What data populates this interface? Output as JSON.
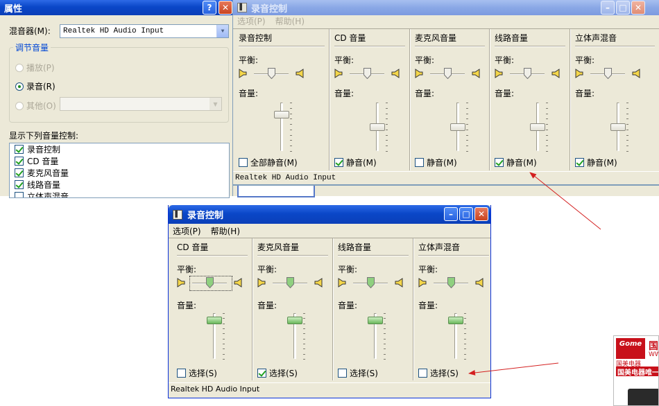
{
  "props": {
    "title": "属性",
    "help_btn": "?",
    "mixer_label": "混音器(M):",
    "mixer_value": "Realtek HD Audio Input",
    "adjust_group": "调节音量",
    "radio_playback": "播放(P)",
    "radio_record": "录音(R)",
    "radio_other": "其他(O)",
    "show_label": "显示下列音量控制:",
    "list": [
      {
        "label": "录音控制",
        "checked": true
      },
      {
        "label": "CD 音量",
        "checked": true
      },
      {
        "label": "麦克风音量",
        "checked": true
      },
      {
        "label": "线路音量",
        "checked": true
      },
      {
        "label": "立体声混音",
        "checked": false
      }
    ]
  },
  "rec1": {
    "title": "录音控制",
    "menu": [
      "选项(P)",
      "帮助(H)"
    ],
    "balance": "平衡:",
    "volume": "音量:",
    "cols": [
      {
        "title": "录音控制",
        "check_label": "全部静音(M)",
        "checked": false,
        "volume": 0.8
      },
      {
        "title": "CD 音量",
        "check_label": "静音(M)",
        "checked": true,
        "volume": 0.5
      },
      {
        "title": "麦克风音量",
        "check_label": "静音(M)",
        "checked": false,
        "volume": 0.5
      },
      {
        "title": "线路音量",
        "check_label": "静音(M)",
        "checked": true,
        "volume": 0.5
      },
      {
        "title": "立体声混音",
        "check_label": "静音(M)",
        "checked": true,
        "volume": 0.5
      }
    ],
    "status": "Realtek HD Audio Input"
  },
  "rec2": {
    "title": "录音控制",
    "menu": [
      "选项(P)",
      "帮助(H)"
    ],
    "balance": "平衡:",
    "volume": "音量:",
    "cols": [
      {
        "title": "CD 音量",
        "check_label": "选择(S)",
        "checked": false,
        "volume": 0.9
      },
      {
        "title": "麦克风音量",
        "check_label": "选择(S)",
        "checked": true,
        "volume": 0.9
      },
      {
        "title": "线路音量",
        "check_label": "选择(S)",
        "checked": false,
        "volume": 0.9
      },
      {
        "title": "立体声混音",
        "check_label": "选择(S)",
        "checked": false,
        "volume": 0.9
      }
    ],
    "status": "Realtek HD Audio Input"
  },
  "ad": {
    "logo": "Gome",
    "brand": "国美电器",
    "line1": "国",
    "line2": "WW",
    "tagline": "国美电器唯一"
  },
  "colors": {
    "annotation_arrow": "#d42020",
    "xp_blue": "#0a47c8",
    "face": "#ece9d8"
  }
}
